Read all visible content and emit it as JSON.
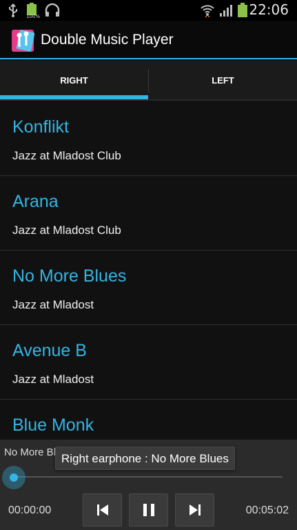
{
  "status_bar": {
    "time": "22:06",
    "battery_small_label": "100%",
    "icons": [
      "usb-icon",
      "battery-icon",
      "headset-icon",
      "wifi-icon",
      "signal-icon",
      "battery-icon"
    ]
  },
  "app": {
    "title": "Double Music Player",
    "icon": "earphones-app-icon"
  },
  "tabs": [
    {
      "label": "RIGHT",
      "selected": true
    },
    {
      "label": "LEFT",
      "selected": false
    }
  ],
  "tracks": [
    {
      "title": "Konflikt",
      "album": "Jazz at Mladost Club"
    },
    {
      "title": "Arana",
      "album": "Jazz at Mladost Club"
    },
    {
      "title": "No More Blues",
      "album": "Jazz at Mladost"
    },
    {
      "title": "Avenue B",
      "album": "Jazz at Mladost"
    },
    {
      "title": "Blue Monk",
      "album": ""
    }
  ],
  "player": {
    "now_playing": "No More Blues",
    "toast": "Right earphone : No More Blues",
    "elapsed": "00:00:00",
    "total": "00:05:02",
    "progress": 0.0,
    "buttons": [
      "previous-icon",
      "pause-icon",
      "next-icon"
    ]
  },
  "colors": {
    "accent": "#33b5e5",
    "background": "#111111",
    "panel": "#2b2b2b"
  }
}
